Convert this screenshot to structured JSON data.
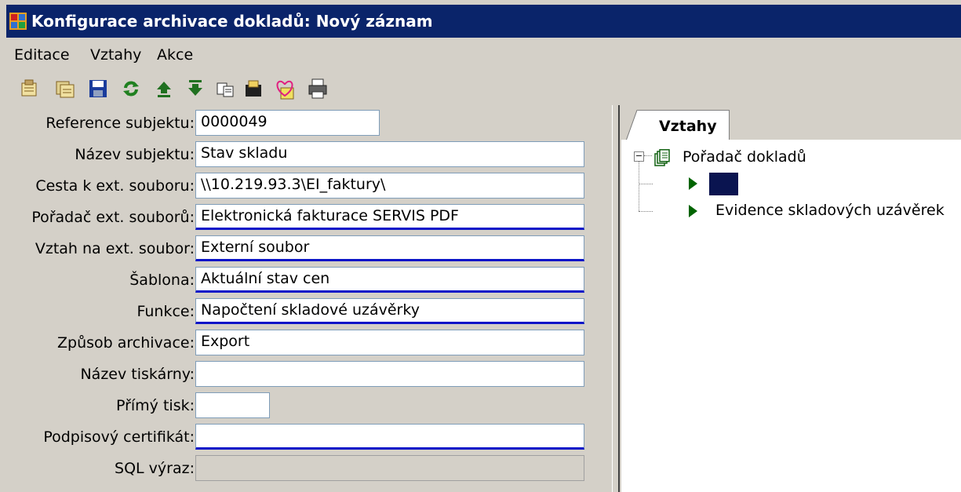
{
  "window": {
    "title": "Konfigurace archivace dokladů: Nový záznam"
  },
  "menu": [
    "Editace",
    "Vztahy",
    "Akce"
  ],
  "toolbar": {
    "icons": [
      "new-record-icon",
      "copy-record-icon",
      "save-icon",
      "refresh-icon",
      "move-up-icon",
      "move-down-icon",
      "paste-icon",
      "folder-icon",
      "heart-icon",
      "print-icon"
    ]
  },
  "form": {
    "fields": [
      {
        "label": "Reference subjektu:",
        "value": "0000049"
      },
      {
        "label": "Název subjektu:",
        "value": "Stav skladu"
      },
      {
        "label": "Cesta k ext. souboru:",
        "value": "\\\\10.219.93.3\\EI_faktury\\"
      },
      {
        "label": "Pořadač ext. souborů:",
        "value": "Elektronická fakturace SERVIS PDF"
      },
      {
        "label": "Vztah na ext. soubor:",
        "value": "Externí soubor"
      },
      {
        "label": "Šablona:",
        "value": "Aktuální stav cen"
      },
      {
        "label": "Funkce:",
        "value": "Napočtení skladové uzávěrky"
      },
      {
        "label": "Způsob archivace:",
        "value": "Export"
      },
      {
        "label": "Název tiskárny:",
        "value": ""
      },
      {
        "label": "Přímý tisk:",
        "value": ""
      },
      {
        "label": "Podpisový certifikát:",
        "value": ""
      },
      {
        "label": "SQL výraz:",
        "value": ""
      }
    ]
  },
  "tabs": {
    "relations": "Vztahy"
  },
  "tree": {
    "root": "Pořadač dokladů",
    "children": [
      "",
      "Evidence skladových uzávěrek"
    ]
  },
  "colors": {
    "title_bg": "#0a246a",
    "required_underline": "#0a14c8",
    "tree_arrow": "#006400",
    "selected_node": "#0a1450"
  }
}
